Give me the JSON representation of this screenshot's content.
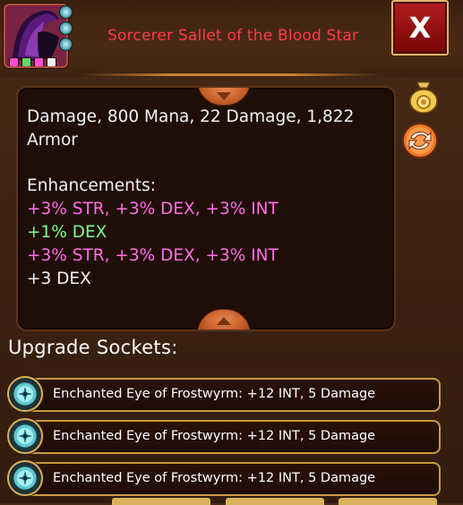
{
  "item": {
    "title": "Sorcerer Sallet of the Blood Star",
    "gem_dot_colors": [
      "#ff4fd0",
      "#61d96a",
      "#ff4fd0",
      "#f2f2f2"
    ]
  },
  "window": {
    "close_label": "X"
  },
  "description": {
    "lines": [
      {
        "text": "Damage, 800 Mana, 22 Damage, 1,822",
        "color": "white"
      },
      {
        "text": "Armor",
        "color": "white"
      },
      {
        "text": "",
        "color": "white"
      },
      {
        "text": "Enhancements:",
        "color": "white"
      },
      {
        "text": "+3% STR, +3% DEX, +3% INT",
        "color": "pink"
      },
      {
        "text": "+1% DEX",
        "color": "green"
      },
      {
        "text": "+3% STR, +3% DEX, +3% INT",
        "color": "pink"
      },
      {
        "text": "+3 DEX",
        "color": "white"
      }
    ]
  },
  "sockets": {
    "heading": "Upgrade Sockets:",
    "items": [
      {
        "label": "Enchanted Eye of Frostwyrm: +12 INT, 5 Damage"
      },
      {
        "label": "Enchanted Eye of Frostwyrm: +12 INT, 5 Damage"
      },
      {
        "label": "Enchanted Eye of Frostwyrm: +12 INT, 5 Damage"
      }
    ]
  },
  "icons": {
    "sell": "coin-bag-icon",
    "swap": "swap-arrows-icon",
    "scroll_up": "scroll-up-icon",
    "scroll_down": "scroll-down-icon",
    "socket_gem": "frostwyrm-eye-gem-icon"
  },
  "colors": {
    "title_red": "#ff3b4a",
    "enhancement_pink": "#ff6ee7",
    "enhancement_green": "#7dff8a",
    "gold_border": "#c89a3c"
  }
}
